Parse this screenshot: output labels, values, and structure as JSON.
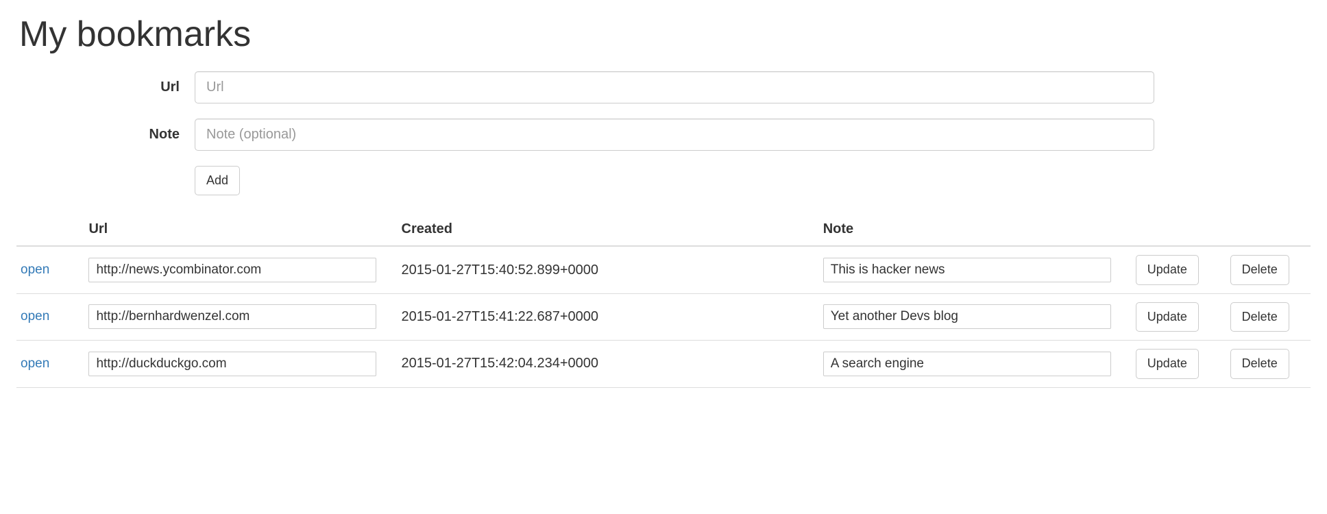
{
  "page": {
    "title": "My bookmarks"
  },
  "form": {
    "url_label": "Url",
    "url_placeholder": "Url",
    "note_label": "Note",
    "note_placeholder": "Note (optional)",
    "add_label": "Add"
  },
  "table": {
    "headers": {
      "url": "Url",
      "created": "Created",
      "note": "Note"
    },
    "open_link_label": "open",
    "update_label": "Update",
    "delete_label": "Delete",
    "rows": [
      {
        "url": "http://news.ycombinator.com",
        "created": "2015-01-27T15:40:52.899+0000",
        "note": "This is hacker news"
      },
      {
        "url": "http://bernhardwenzel.com",
        "created": "2015-01-27T15:41:22.687+0000",
        "note": "Yet another Devs blog"
      },
      {
        "url": "http://duckduckgo.com",
        "created": "2015-01-27T15:42:04.234+0000",
        "note": "A search engine"
      }
    ]
  }
}
